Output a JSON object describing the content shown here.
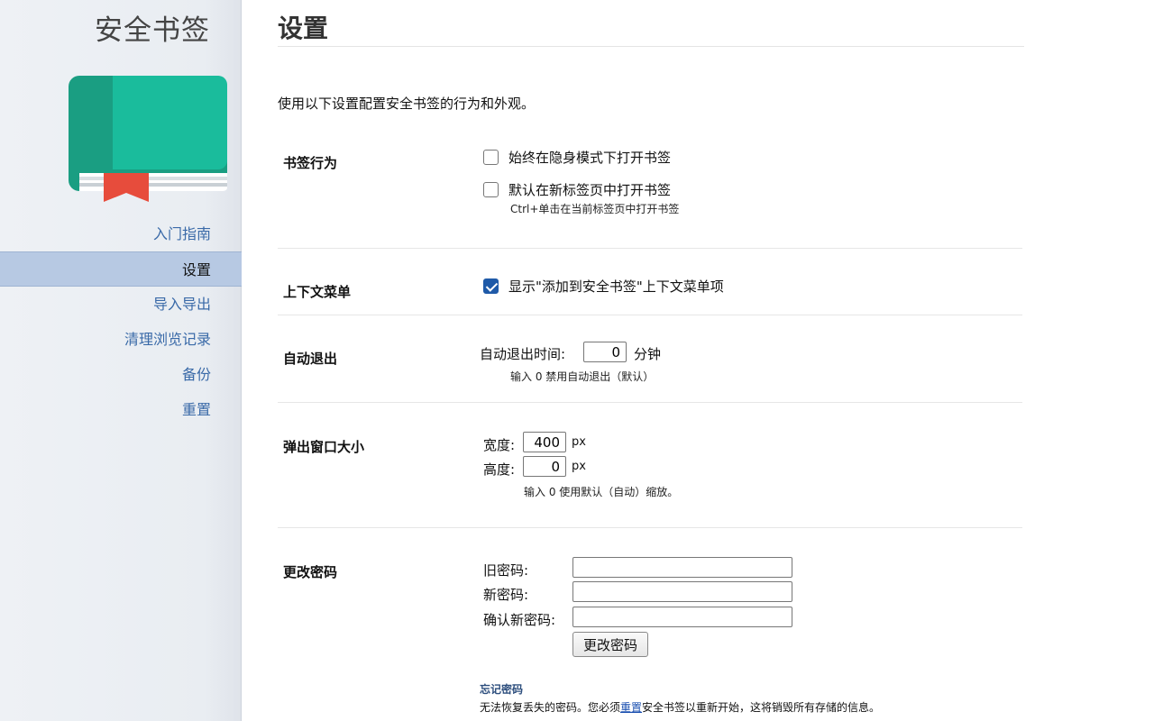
{
  "sidebar": {
    "app_title": "安全书签",
    "logo_icon": "book-icon",
    "nav": [
      {
        "label": "入门指南",
        "active": false
      },
      {
        "label": "设置",
        "active": true
      },
      {
        "label": "导入导出",
        "active": false
      },
      {
        "label": "清理浏览记录",
        "active": false
      },
      {
        "label": "备份",
        "active": false
      },
      {
        "label": "重置",
        "active": false
      }
    ]
  },
  "main": {
    "title": "设置",
    "intro": "使用以下设置配置安全书签的行为和外观。",
    "bookmark_behavior": {
      "label": "书签行为",
      "incognito_option": "始终在隐身模式下打开书签",
      "incognito_checked": false,
      "newtab_option": "默认在新标签页中打开书签",
      "newtab_checked": false,
      "newtab_hint": "Ctrl+单击在当前标签页中打开书签"
    },
    "context_menu": {
      "label": "上下文菜单",
      "option": "显示\"添加到安全书签\"上下文菜单项",
      "checked": true
    },
    "auto_logout": {
      "label": "自动退出",
      "field_label": "自动退出时间:",
      "value": "0",
      "unit": "分钟",
      "hint": "输入 0 禁用自动退出（默认）"
    },
    "popup_size": {
      "label": "弹出窗口大小",
      "width_label": "宽度:",
      "width_value": "400",
      "height_label": "高度:",
      "height_value": "0",
      "unit": "px",
      "hint": "输入 0 使用默认（自动）缩放。"
    },
    "change_password": {
      "label": "更改密码",
      "old_label": "旧密码:",
      "new_label": "新密码:",
      "confirm_label": "确认新密码:",
      "button": "更改密码",
      "forgot_title": "忘记密码",
      "forgot_text_before": "无法恢复丢失的密码。您必须",
      "forgot_link": "重置",
      "forgot_text_after": "安全书签以重新开始，这将销毁所有存储的信息。"
    }
  },
  "colors": {
    "accent": "#1f5aa8",
    "nav_active_bg": "#b7c9e3",
    "book_green": "#1abc9c",
    "ribbon_red": "#e74c3c"
  }
}
